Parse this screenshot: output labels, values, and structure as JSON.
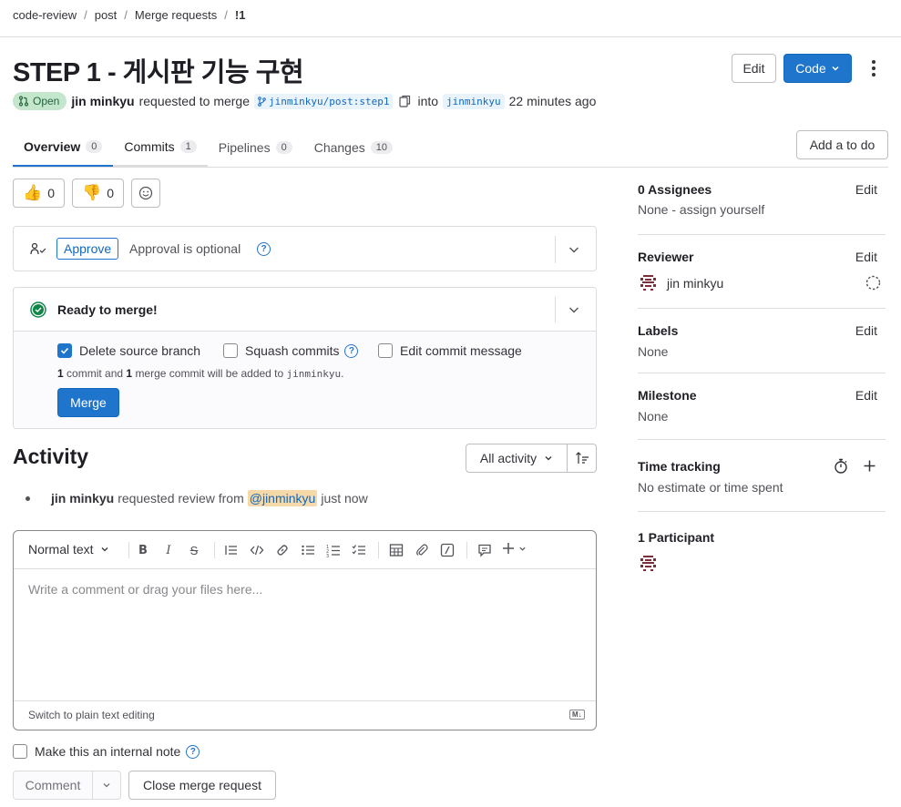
{
  "breadcrumb": {
    "items": [
      "code-review",
      "post",
      "Merge requests",
      "!1"
    ]
  },
  "header": {
    "title": "STEP 1 - 게시판 기능 구현",
    "edit_label": "Edit",
    "code_label": "Code"
  },
  "meta": {
    "status": "Open",
    "author": "jin minkyu",
    "action": "requested to merge",
    "source_branch": "jinminkyu/post:step1",
    "into": "into",
    "target_branch": "jinminkyu",
    "time": "22 minutes ago"
  },
  "tabs": [
    {
      "label": "Overview",
      "count": "0"
    },
    {
      "label": "Commits",
      "count": "1"
    },
    {
      "label": "Pipelines",
      "count": "0"
    },
    {
      "label": "Changes",
      "count": "10"
    }
  ],
  "add_todo_label": "Add a to do",
  "reactions": {
    "thumbs_up": "0",
    "thumbs_down": "0"
  },
  "approval": {
    "button": "Approve",
    "text": "Approval is optional"
  },
  "merge": {
    "status": "Ready to merge!",
    "delete_source": "Delete source branch",
    "squash": "Squash commits",
    "edit_message": "Edit commit message",
    "summary_n1": "1",
    "summary_t1": "commit and",
    "summary_n2": "1",
    "summary_t2": "merge commit will be added to",
    "summary_branch": "jinminkyu",
    "summary_end": ".",
    "button": "Merge"
  },
  "activity": {
    "title": "Activity",
    "filter": "All activity",
    "item_author": "jin minkyu",
    "item_text": "requested review from",
    "item_mention": "@jinminkyu",
    "item_time": "just now"
  },
  "editor": {
    "format": "Normal text",
    "placeholder": "Write a comment or drag your files here...",
    "switch_label": "Switch to plain text editing",
    "md_badge": "M↓"
  },
  "internal_note": "Make this an internal note",
  "comment_button": "Comment",
  "close_button": "Close merge request",
  "sidebar": {
    "assignees_title": "0 Assignees",
    "assignees_value": "None - assign yourself",
    "reviewer_title": "Reviewer",
    "reviewer_name": "jin minkyu",
    "labels_title": "Labels",
    "labels_value": "None",
    "milestone_title": "Milestone",
    "milestone_value": "None",
    "time_title": "Time tracking",
    "time_value": "No estimate or time spent",
    "participants_title": "1 Participant",
    "edit_label": "Edit"
  },
  "colors": {
    "accent": "#1f75cb",
    "success": "#108548",
    "open_badge_bg": "#c3e6cd"
  }
}
